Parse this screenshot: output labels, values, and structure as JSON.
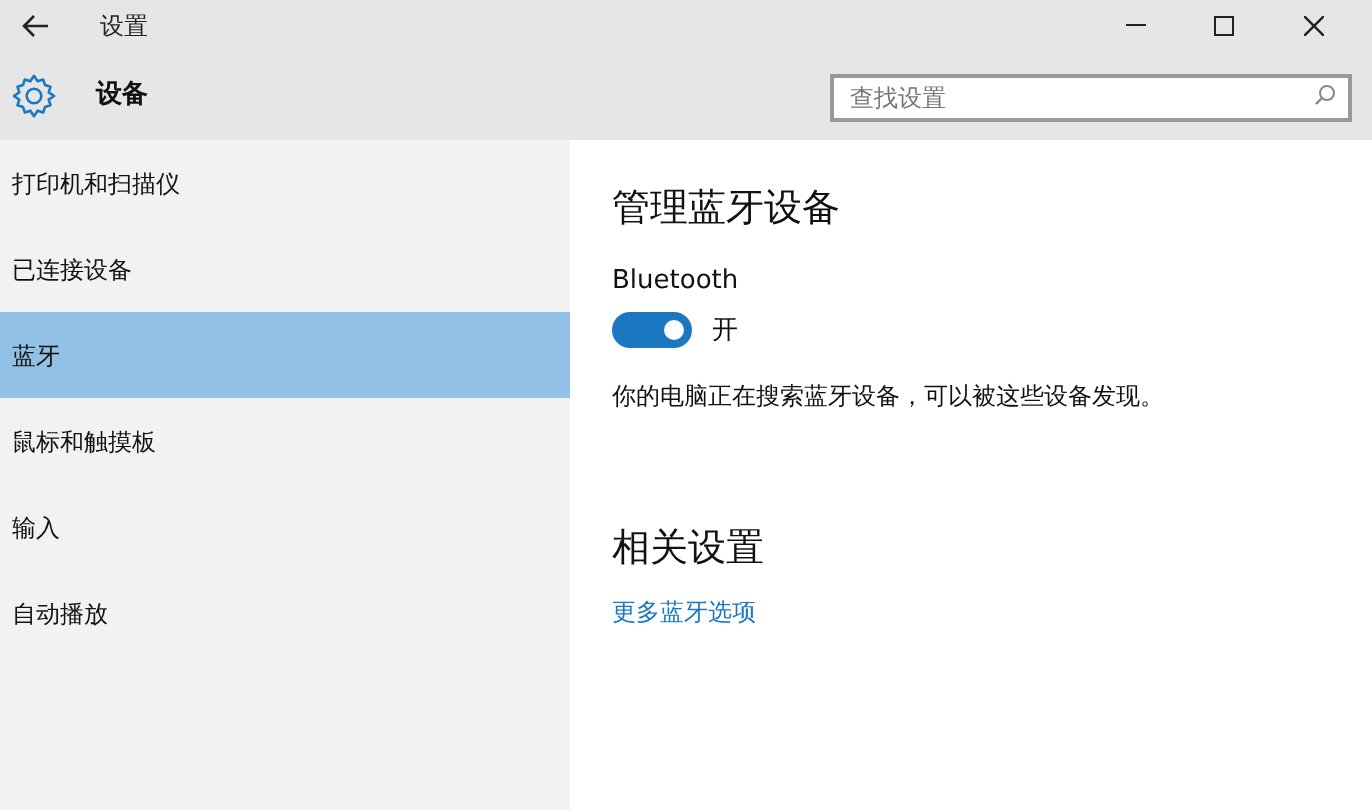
{
  "window": {
    "title": "设置"
  },
  "header": {
    "title": "设备",
    "search": {
      "placeholder": "查找设置"
    }
  },
  "sidebar": {
    "items": [
      {
        "label": "打印机和扫描仪",
        "selected": false
      },
      {
        "label": "已连接设备",
        "selected": false
      },
      {
        "label": "蓝牙",
        "selected": true
      },
      {
        "label": "鼠标和触摸板",
        "selected": false
      },
      {
        "label": "输入",
        "selected": false
      },
      {
        "label": "自动播放",
        "selected": false
      }
    ]
  },
  "content": {
    "title": "管理蓝牙设备",
    "bluetooth": {
      "label": "Bluetooth",
      "on": true,
      "state_text": "开"
    },
    "status": "你的电脑正在搜索蓝牙设备，可以被这些设备发现。",
    "related_title": "相关设置",
    "related_link": "更多蓝牙选项"
  }
}
